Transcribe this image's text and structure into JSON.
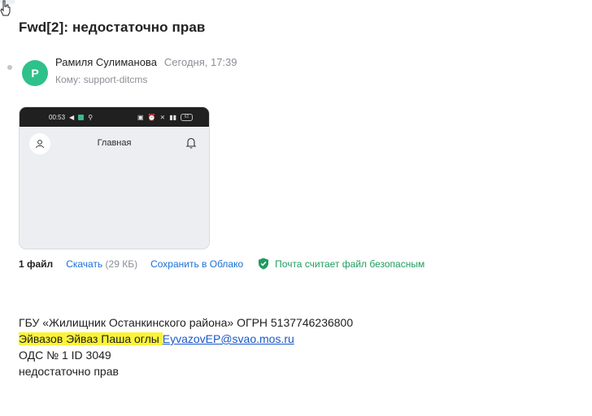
{
  "message": {
    "subject": "Fwd[2]: недостаточно прав",
    "sender_initial": "Р",
    "sender_name": "Рамиля Сулиманова",
    "date": "Сегодня, 17:39",
    "to_label": "Кому:",
    "to_value": "support-ditcms"
  },
  "attachment_preview": {
    "status_time": "00:53",
    "battery": "62",
    "app_title": "Главная"
  },
  "attachments_bar": {
    "count_label": "1 файл",
    "download_label": "Скачать",
    "download_size": "(29 КБ)",
    "save_label": "Сохранить в Облако",
    "safe_label": "Почта считает файл безопасным"
  },
  "body": {
    "line1": "ГБУ «Жилищник Останкинского района» ОГРН 5137746236800",
    "line2_name": "Эйвазов Эйваз Паша оглы",
    "line2_email": "EyvazovEP@svao.mos.ru",
    "line3": "ОДС № 1 ID 3049",
    "line4": "недостаточно прав"
  },
  "colors": {
    "avatar": "#2fc18a",
    "link": "#1a6fd8",
    "safe": "#1e9d5c",
    "highlight": "#fbf33a"
  }
}
